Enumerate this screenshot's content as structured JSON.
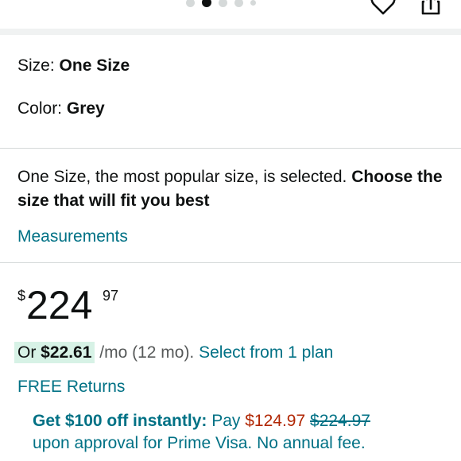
{
  "header": {
    "carousel": {
      "count": 5,
      "active_index": 1
    }
  },
  "product": {
    "size_label": "Size: ",
    "size_value": "One Size",
    "color_label": "Color: ",
    "color_value": "Grey",
    "size_note": "One Size, the most popular size, is selected. ",
    "size_note_bold": "Choose the size that will fit you best",
    "measurements_link": "Measurements"
  },
  "pricing": {
    "currency": "$",
    "whole": "224",
    "fraction": "97",
    "monthly_prefix": "Or ",
    "monthly_amount": "$22.61",
    "monthly_suffix": " /mo (12 mo). ",
    "plan_link": "Select from 1 plan",
    "free_returns": "FREE Returns",
    "promo_bold": "Get $100 off instantly:",
    "promo_pay": " Pay ",
    "promo_new_price": "$124.97",
    "promo_old_price": "$224.97",
    "promo_rest": "upon approval for Prime Visa. No annual fee."
  },
  "colors": {
    "link": "#007185",
    "sale": "#b12704",
    "highlight": "#d7f2e6"
  }
}
